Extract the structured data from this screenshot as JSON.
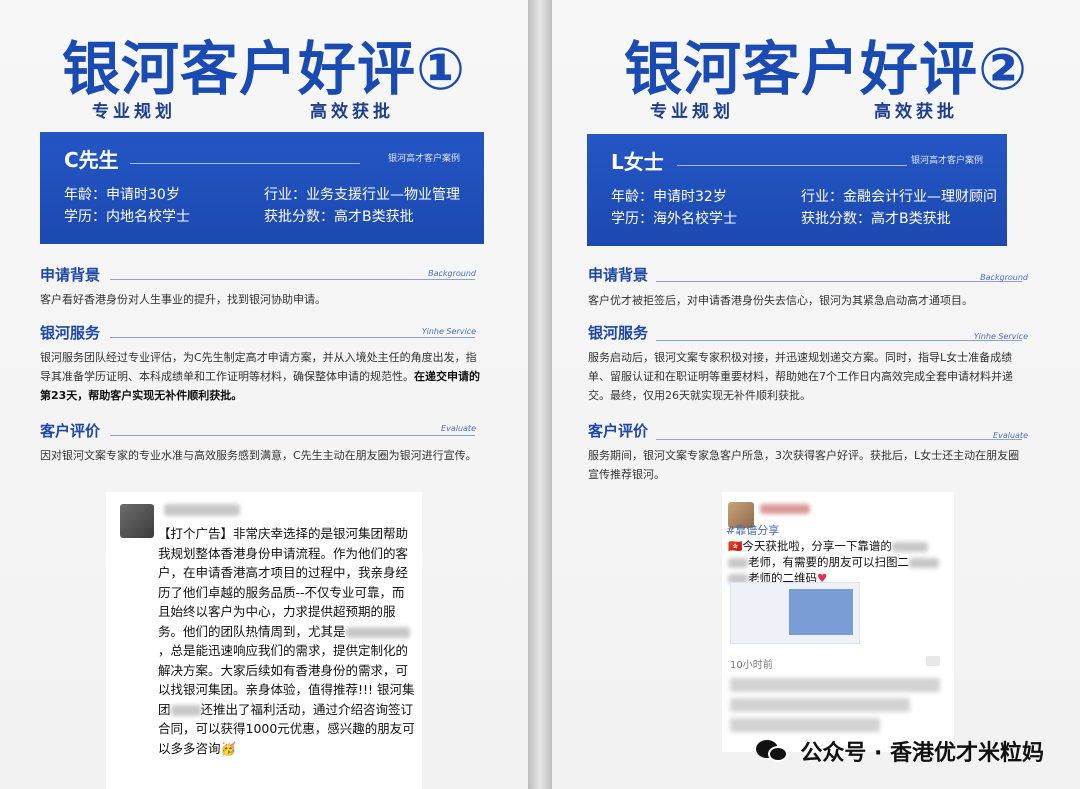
{
  "left": {
    "title": "银河客户好评①",
    "subtitle_1": "专业规划",
    "subtitle_2": "高效获批",
    "card": {
      "name": "C先生",
      "case_tag": "银河高才客户案例",
      "age": "年龄：申请时30岁",
      "industry": "行业：业务支援行业—物业管理",
      "education": "学历：内地名校学士",
      "score": "获批分数：高才B类获批"
    },
    "sections": [
      {
        "heading": "申请背景",
        "english": "Background",
        "text": "客户看好香港身份对人生事业的提升，找到银河协助申请。"
      },
      {
        "heading": "银河服务",
        "english": "Yinhe Service",
        "text": "银河服务团队经过专业评估，为C先生制定高才申请方案，并从入境处主任的角度出发，指导其准备学历证明、本科成绩单和工作证明等材料，确保整体申请的规范性。",
        "bold": "在递交申请的第23天，帮助客户实现无补件顺利获批。"
      },
      {
        "heading": "客户评价",
        "english": "Evaluate",
        "text": "因对银河文案专家的专业水准与高效服务感到满意，C先生主动在朋友圈为银河进行宣传。"
      }
    ],
    "post": {
      "text": "【打个广告】非常庆幸选择的是银河集团帮助我规划整体香港身份申请流程。作为他们的客户，在申请香港高才项目的过程中，我亲身经历了他们卓越的服务品质--不仅专业可靠，而且始终以客户为中心，力求提供超预期的服务。他们的团队热情周到，尤其是",
      "text_2": "，总是能迅速响应我们的需求，提供定制化的解决方案。大家后续如有香港身份的需求，可以找银河集团。亲身体验，值得推荐!!! 银河集团",
      "text_3": "还推出了福利活动，通过介绍咨询签订合同，可以获得1000元优惠，感兴趣的朋友可以多多咨询🥳"
    }
  },
  "right": {
    "title": "银河客户好评②",
    "subtitle_1": "专业规划",
    "subtitle_2": "高效获批",
    "card": {
      "name": "L女士",
      "case_tag": "银河高才客户案例",
      "age": "年龄：申请时32岁",
      "industry": "行业：金融会计行业—理财顾问",
      "education": "学历：海外名校学士",
      "score": "获批分数：高才B类获批"
    },
    "sections": [
      {
        "heading": "申请背景",
        "english": "Background",
        "text": "客户优才被拒签后，对申请香港身份失去信心，银河为其紧急启动高才通项目。"
      },
      {
        "heading": "银河服务",
        "english": "Yinhe Service",
        "text": "服务启动后，银河文案专家积极对接，并迅速规划递交方案。同时，指导L女士准备成绩单、留服认证和在职证明等重要材料，帮助她在7个工作日内高效完成全套申请材料并递交。最终，仅用26天就实现无补件顺利获批。"
      },
      {
        "heading": "客户评价",
        "english": "Evaluate",
        "text": "服务期间，银河文案专家急客户所急，3次获得客户好评。获批后，L女士还主动在朋友圈宣传推荐银河。"
      }
    ],
    "post": {
      "tag": "#靠谱分享",
      "text": "今天获批啦，分享一下靠谱的",
      "text_2": "老师，有需要的朋友可以扫图二",
      "text_3": "老师的二维码",
      "time": "10小时前"
    }
  },
  "watermark": "公众号 · 香港优才米粒妈"
}
